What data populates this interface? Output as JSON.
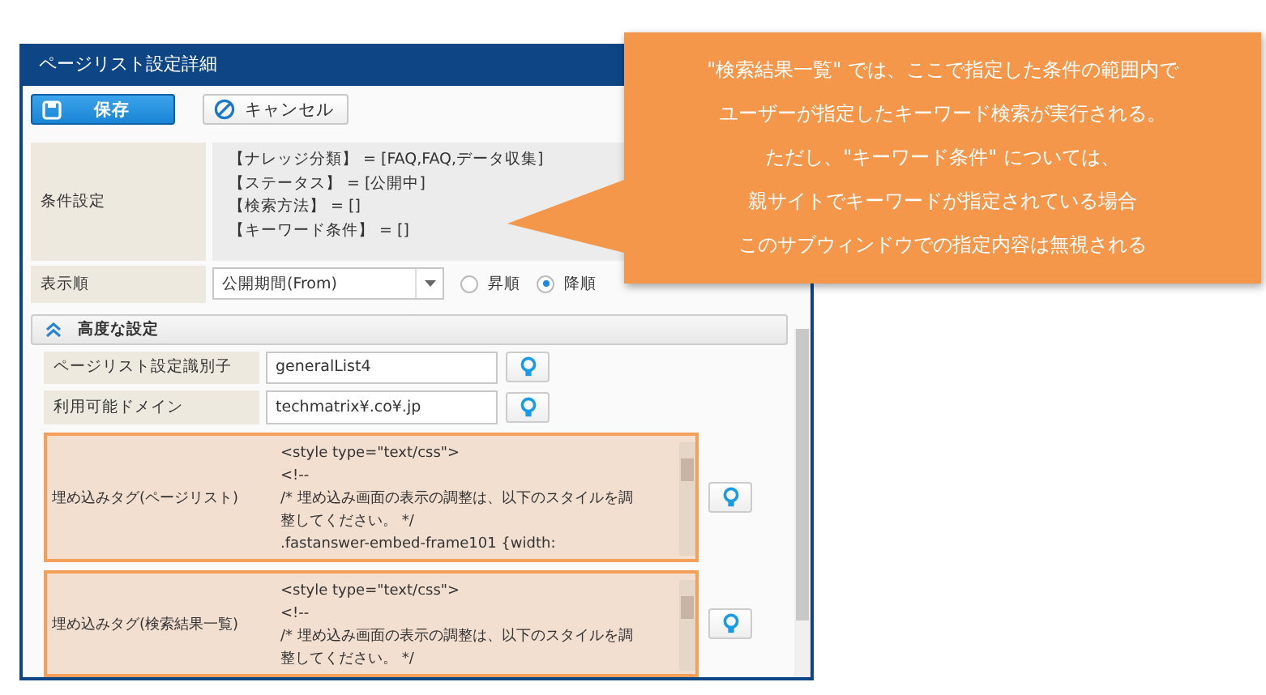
{
  "window": {
    "title": "ページリスト設定詳細"
  },
  "toolbar": {
    "save": "保存",
    "cancel": "キャンセル"
  },
  "conditions": {
    "label": "条件設定",
    "lines": [
      "【ナレッジ分類】 = [FAQ,FAQ,データ収集]",
      "【ステータス】 = [公開中]",
      "【検索方法】 = []",
      "【キーワード条件】 = []"
    ]
  },
  "sort": {
    "label": "表示順",
    "value": "公開期間(From)",
    "options": [
      {
        "label": "昇順",
        "selected": false
      },
      {
        "label": "降順",
        "selected": true
      }
    ]
  },
  "advanced": {
    "title": "高度な設定",
    "expanded": true
  },
  "fields": [
    {
      "label": "ページリスト設定識別子",
      "value": "generalList4"
    },
    {
      "label": "利用可能ドメイン",
      "value": "techmatrix¥.co¥.jp"
    }
  ],
  "embeds": [
    {
      "label": "埋め込みタグ(ページリスト)",
      "highlighted": true,
      "lines": [
        "<style type=\"text/css\">",
        "<!--",
        "/* 埋め込み画面の表示の調整は、以下のスタイルを調",
        "整してください。 */",
        ".fastanswer-embed-frame101 {width:"
      ]
    },
    {
      "label": "埋め込みタグ(検索結果一覧)",
      "highlighted": true,
      "lines": [
        "<style type=\"text/css\">",
        "<!--",
        "/* 埋め込み画面の表示の調整は、以下のスタイルを調",
        "整してください。 */"
      ]
    }
  ],
  "callout": {
    "lines": [
      "\"検索結果一覧\" では、ここで指定した条件の範囲内で",
      "ユーザーが指定したキーワード検索が実行される。",
      "ただし、\"キーワード条件\" については、",
      "親サイトでキーワードが指定されている場合",
      "このサブウィンドウでの指定内容は無視される"
    ]
  }
}
